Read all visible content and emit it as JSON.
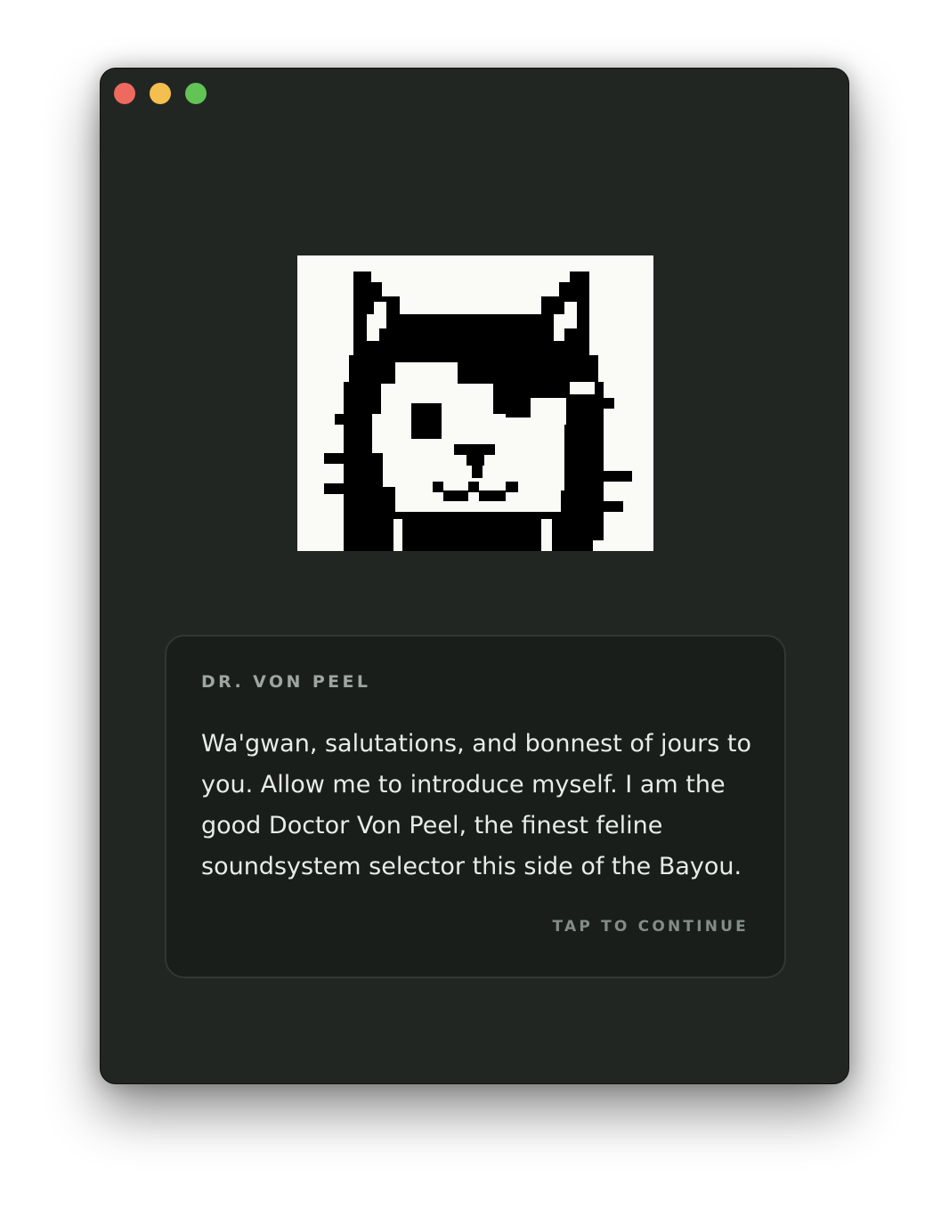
{
  "window": {
    "controls": [
      {
        "name": "close",
        "color": "#ee6a5e"
      },
      {
        "name": "minimize",
        "color": "#f5bf4f"
      },
      {
        "name": "zoom",
        "color": "#61c454"
      }
    ]
  },
  "portrait": {
    "icon": "pixel-cat-portrait",
    "colors": {
      "ink": "#000000",
      "paper": "#fafaf6"
    }
  },
  "dialog": {
    "speaker": "DR. VON PEEL",
    "text": "Wa'gwan, salutations, and bonnest of jours to you. Allow me to introduce myself. I am the good Doctor Von Peel, the finest feline soundsystem selector this side of the Bayou.",
    "continue_label": "TAP TO CONTINUE"
  }
}
